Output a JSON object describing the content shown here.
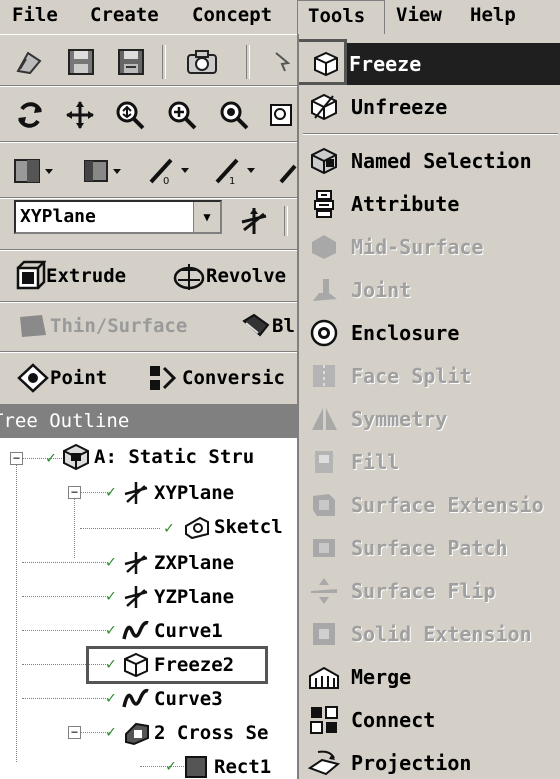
{
  "menubar": {
    "items": [
      "File",
      "Create",
      "Concept",
      "Tools",
      "View",
      "Help"
    ]
  },
  "toolbar": {
    "plane_select": "XYPlane",
    "extrude": "Extrude",
    "revolve": "Revolve",
    "thin_surface": "Thin/Surface",
    "blend": "Bl",
    "point": "Point",
    "conversion": "Conversic"
  },
  "tree": {
    "header": "Tree Outline",
    "nodes": [
      {
        "label": "A: Static Stru",
        "icon": "model-icon"
      },
      {
        "label": "XYPlane",
        "icon": "plane-icon"
      },
      {
        "label": "Sketcl",
        "icon": "sketch-icon"
      },
      {
        "label": "ZXPlane",
        "icon": "plane-icon"
      },
      {
        "label": "YZPlane",
        "icon": "plane-icon"
      },
      {
        "label": "Curve1",
        "icon": "curve-icon"
      },
      {
        "label": "Freeze2",
        "icon": "freeze-icon"
      },
      {
        "label": "Curve3",
        "icon": "curve-icon"
      },
      {
        "label": "2 Cross Se",
        "icon": "cross-section-icon"
      },
      {
        "label": "Rect1",
        "icon": "rect-icon"
      }
    ]
  },
  "tools_menu": {
    "items": [
      {
        "label": "Freeze",
        "icon": "freeze-icon",
        "enabled": true,
        "highlighted": true
      },
      {
        "label": "Unfreeze",
        "icon": "unfreeze-icon",
        "enabled": true
      },
      {
        "label": "Named Selection",
        "icon": "named-selection-icon",
        "enabled": true
      },
      {
        "label": "Attribute",
        "icon": "attribute-icon",
        "enabled": true
      },
      {
        "label": "Mid-Surface",
        "icon": "mid-surface-icon",
        "enabled": false
      },
      {
        "label": "Joint",
        "icon": "joint-icon",
        "enabled": false
      },
      {
        "label": "Enclosure",
        "icon": "enclosure-icon",
        "enabled": true
      },
      {
        "label": "Face Split",
        "icon": "face-split-icon",
        "enabled": false
      },
      {
        "label": "Symmetry",
        "icon": "symmetry-icon",
        "enabled": false
      },
      {
        "label": "Fill",
        "icon": "fill-icon",
        "enabled": false
      },
      {
        "label": "Surface Extensio",
        "icon": "surface-extension-icon",
        "enabled": false
      },
      {
        "label": "Surface Patch",
        "icon": "surface-patch-icon",
        "enabled": false
      },
      {
        "label": "Surface Flip",
        "icon": "surface-flip-icon",
        "enabled": false
      },
      {
        "label": "Solid Extension",
        "icon": "solid-extension-icon",
        "enabled": false
      },
      {
        "label": "Merge",
        "icon": "merge-icon",
        "enabled": true
      },
      {
        "label": "Connect",
        "icon": "connect-icon",
        "enabled": true
      },
      {
        "label": "Projection",
        "icon": "projection-icon",
        "enabled": true
      }
    ]
  },
  "colors": {
    "chrome": "#d4d0c8",
    "highlight": "#1f1f1f",
    "tree_header": "#808080",
    "check_green": "#2a8a2a"
  }
}
